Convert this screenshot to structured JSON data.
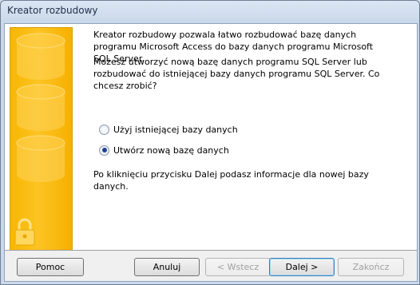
{
  "window": {
    "title": "Kreator rozbudowy"
  },
  "content": {
    "intro": "Kreator rozbudowy pozwala łatwo rozbudować bazę danych programu Microsoft Access do bazy danych programu Microsoft SQL Server.",
    "question": "Możesz utworzyć nową bazę danych programu SQL Server lub rozbudować do istniejącej bazy danych programu SQL Server. Co chcesz zrobić?",
    "option_existing": "Użyj istniejącej bazy danych",
    "option_new": "Utwórz nową bazę danych",
    "selected": "option_new",
    "footer_note": "Po kliknięciu przycisku Dalej podasz informacje dla nowej bazy danych."
  },
  "buttons": {
    "help": "Pomoc",
    "cancel": "Anuluj",
    "back": "< Wstecz",
    "next": "Dalej >",
    "finish": "Zakończ"
  },
  "colors": {
    "sidebar": "#f9bb10",
    "window_frame": "#cbd9ea"
  }
}
